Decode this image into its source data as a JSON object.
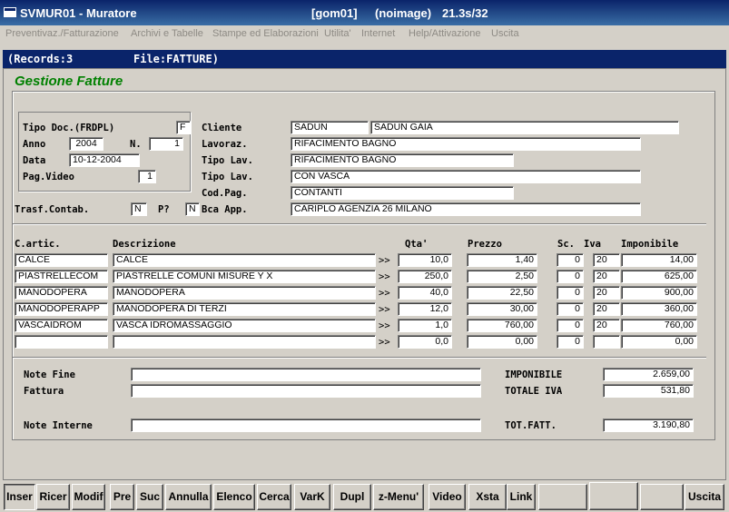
{
  "titlebar": {
    "app": "SVMUR01 - Muratore",
    "session": "[gom01]",
    "image": "(noimage)",
    "timing": "21.3s/32"
  },
  "menu": [
    "Preventivaz./Fatturazione",
    "Archivi e Tabelle",
    "Stampe ed Elaborazioni",
    "Utilita'",
    "Internet",
    "Help/Attivazione",
    "Uscita"
  ],
  "recbar": {
    "records": "(Records:3",
    "file": "File:FATTURE)"
  },
  "form_title": "Gestione Fatture",
  "doc": {
    "tipo_label": "Tipo Doc.(FRDPL)",
    "tipo_value": "F",
    "anno_label": "Anno",
    "anno_value": "2004",
    "n_label": "N.",
    "n_value": "1",
    "data_label": "Data",
    "data_value": "10-12-2004",
    "pag_label": "Pag.Video",
    "pag_value": "1"
  },
  "right": {
    "cliente_label": "Cliente",
    "cliente_code": "SADUN",
    "cliente_name": "SADUN  GAIA",
    "lavoraz_label": "Lavoraz.",
    "lavoraz_value": "RIFACIMENTO BAGNO",
    "tipolav1_label": "Tipo Lav.",
    "tipolav1_value": "RIFACIMENTO BAGNO",
    "tipolav2_label": "Tipo Lav.",
    "tipolav2_value": "CON VASCA",
    "codpag_label": "Cod.Pag.",
    "codpag_value": "CONTANTI",
    "bca_label": "Bca App.",
    "bca_value": "CARIPLO     AGENZIA 26    MILANO"
  },
  "trasf": {
    "label": "Trasf.Contab.",
    "value": "N",
    "p_label": "P?",
    "p_value": "N"
  },
  "columns": {
    "code": "C.artic.",
    "desc": "Descrizione",
    "qty": "Qta'",
    "price": "Prezzo",
    "disc": "Sc.",
    "iva": "Iva",
    "tax": "Imponibile"
  },
  "rows": [
    {
      "code": "CALCE",
      "desc": "CALCE",
      "arrow": ">>",
      "qty": "10,0",
      "price": "1,40",
      "disc": "0",
      "iva": "20",
      "tax": "14,00"
    },
    {
      "code": "PIASTRELLECOM",
      "desc": "PIASTRELLE COMUNI MISURE Y X",
      "arrow": ">>",
      "qty": "250,0",
      "price": "2,50",
      "disc": "0",
      "iva": "20",
      "tax": "625,00"
    },
    {
      "code": "MANODOPERA",
      "desc": "MANODOPERA",
      "arrow": ">>",
      "qty": "40,0",
      "price": "22,50",
      "disc": "0",
      "iva": "20",
      "tax": "900,00"
    },
    {
      "code": "MANODOPERAPP",
      "desc": "MANODOPERA DI TERZI",
      "arrow": ">>",
      "qty": "12,0",
      "price": "30,00",
      "disc": "0",
      "iva": "20",
      "tax": "360,00"
    },
    {
      "code": "VASCAIDROM",
      "desc": "VASCA IDROMASSAGGIO",
      "arrow": ">>",
      "qty": "1,0",
      "price": "760,00",
      "disc": "0",
      "iva": "20",
      "tax": "760,00"
    },
    {
      "code": "",
      "desc": "",
      "arrow": ">>",
      "qty": "0,0",
      "price": "0,00",
      "disc": "0",
      "iva": "",
      "tax": "0,00"
    }
  ],
  "notes": {
    "fine_label1": "Note Fine",
    "fine_label2": "Fattura",
    "fine1": "",
    "fine2": "",
    "interne_label": "Note Interne",
    "interne": ""
  },
  "totals": {
    "imponibile_label": "IMPONIBILE",
    "imponibile": "2.659,00",
    "iva_label": "TOTALE IVA",
    "iva": "531,80",
    "tot_label": "TOT.FATT.",
    "tot": "3.190,80"
  },
  "toolbar": [
    "Inser",
    "Ricer",
    "Modif",
    "Pre",
    "Suc",
    "Annulla",
    "Elenco",
    "Cerca",
    "VarK",
    "Dupl",
    "z-Menu'",
    "Video",
    "Xsta",
    "Link",
    "",
    "",
    "",
    "Uscita"
  ]
}
